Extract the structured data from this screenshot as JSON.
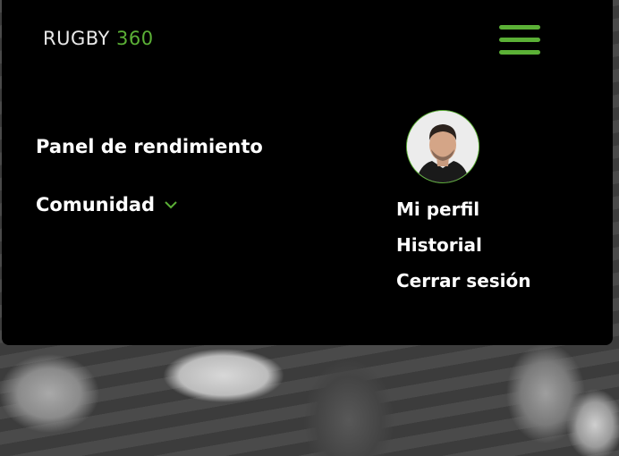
{
  "brand": {
    "name": "RUGBY",
    "accent": "360",
    "accent_color": "#5bb036"
  },
  "header": {
    "menu_icon": "hamburger-menu-icon"
  },
  "nav": {
    "items": [
      {
        "label": "Panel de rendimiento"
      },
      {
        "label": "Comunidad",
        "icon": "chevron-down-icon"
      }
    ]
  },
  "user_menu": {
    "avatar": "avatar",
    "items": [
      {
        "label": "Mi perfil"
      },
      {
        "label": "Historial"
      },
      {
        "label": "Cerrar sesión"
      }
    ]
  }
}
